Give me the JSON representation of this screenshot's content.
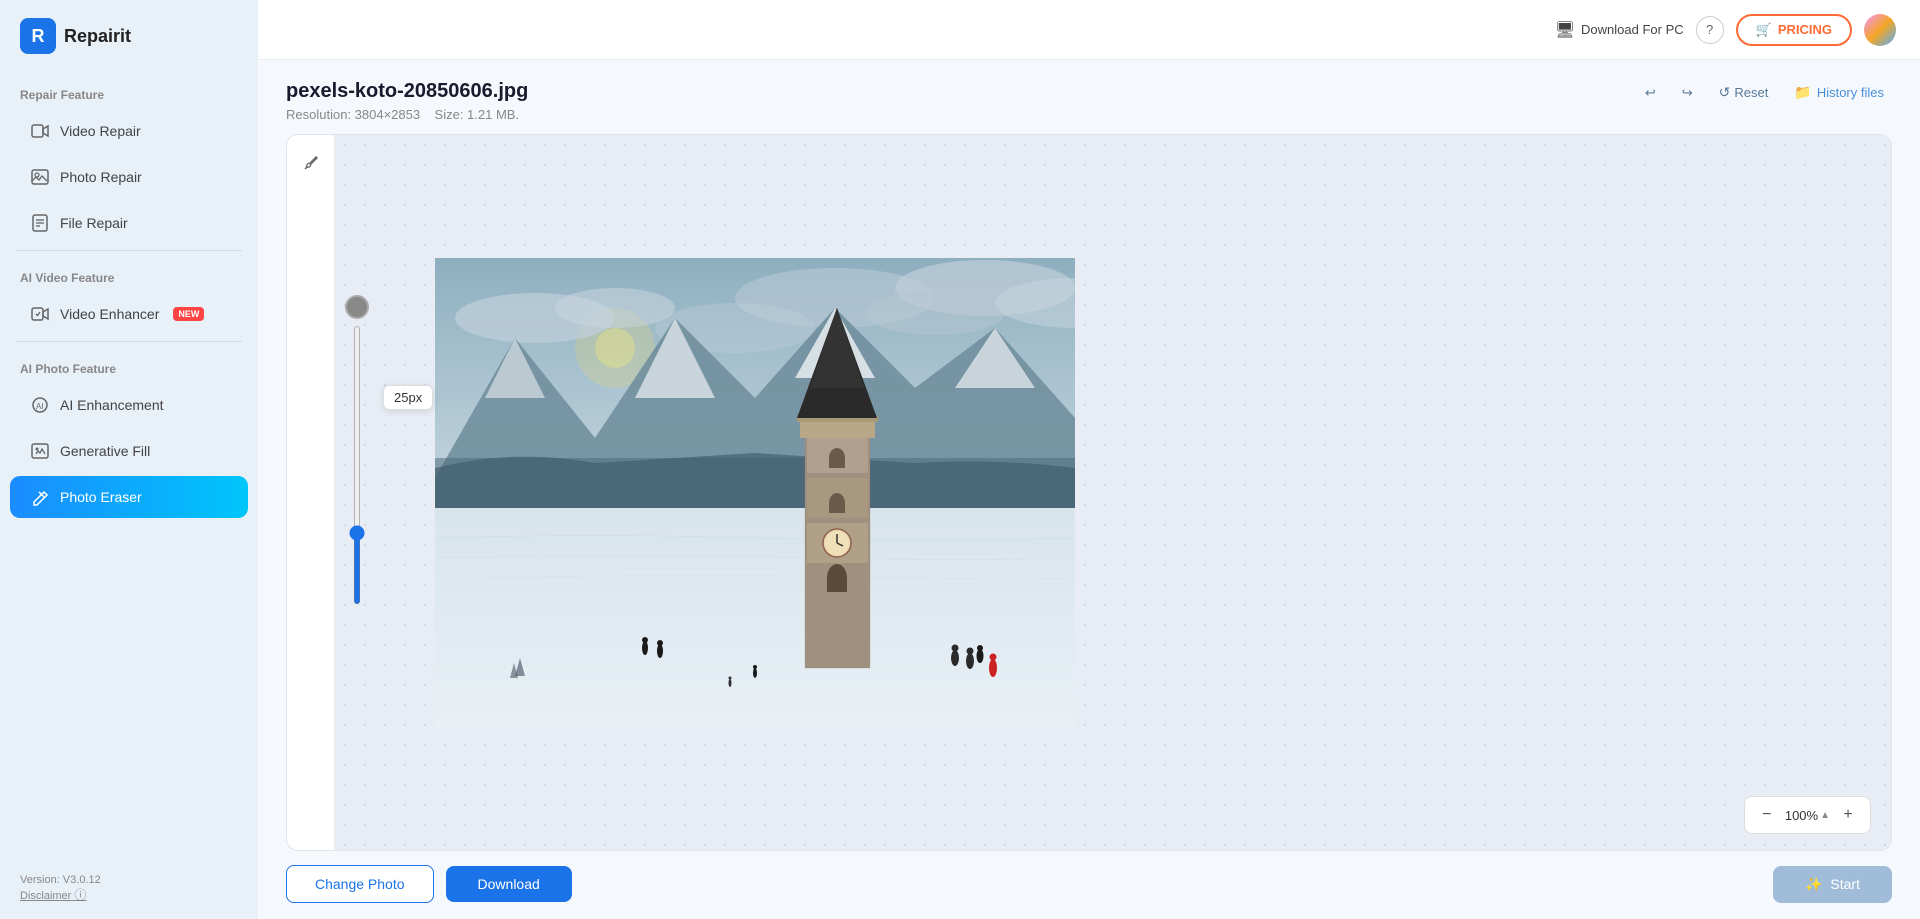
{
  "app": {
    "name": "Repairit",
    "version": "Version: V3.0.12",
    "disclaimer": "Disclaimer"
  },
  "topbar": {
    "download_pc": "Download For PC",
    "pricing": "PRICING",
    "help_icon": "?"
  },
  "sidebar": {
    "sections": [
      {
        "title": "Repair Feature",
        "items": [
          {
            "id": "video-repair",
            "label": "Video Repair",
            "icon": "▶"
          },
          {
            "id": "photo-repair",
            "label": "Photo Repair",
            "icon": "🖼"
          },
          {
            "id": "file-repair",
            "label": "File Repair",
            "icon": "📄"
          }
        ]
      },
      {
        "title": "AI Video Feature",
        "items": [
          {
            "id": "video-enhancer",
            "label": "Video Enhancer",
            "icon": "✨",
            "badge": "NEW"
          }
        ]
      },
      {
        "title": "AI Photo Feature",
        "items": [
          {
            "id": "ai-enhancement",
            "label": "AI Enhancement",
            "icon": "🤖"
          },
          {
            "id": "generative-fill",
            "label": "Generative Fill",
            "icon": "🎨"
          },
          {
            "id": "photo-eraser",
            "label": "Photo Eraser",
            "icon": "🪄",
            "active": true
          }
        ]
      }
    ]
  },
  "file": {
    "name": "pexels-koto-20850606.jpg",
    "resolution": "Resolution: 3804×2853",
    "size": "Size: 1.21 MB."
  },
  "toolbar": {
    "undo_label": "↩",
    "redo_label": "↪",
    "reset_label": "Reset",
    "history_label": "History files"
  },
  "editor": {
    "brush_size": "25px",
    "zoom_value": "100%"
  },
  "actions": {
    "change_photo": "Change Photo",
    "download": "Download",
    "start": "Start"
  }
}
